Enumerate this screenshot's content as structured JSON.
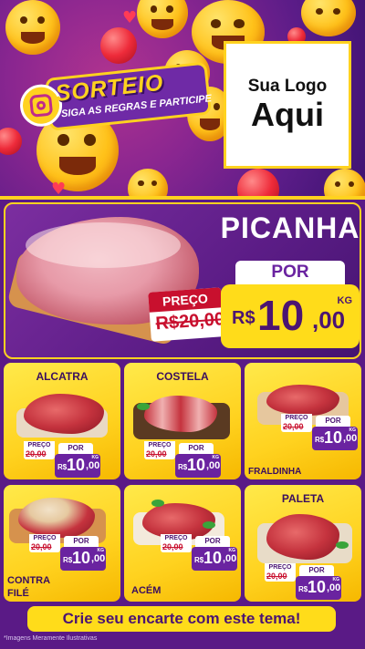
{
  "hero": {
    "sorteio_title": "SORTEIO",
    "sorteio_subtitle": "SIGA AS REGRAS E PARTICIPE",
    "logo_line1": "Sua Logo",
    "logo_line2": "Aqui"
  },
  "featured": {
    "name": "PICANHA",
    "por_label": "POR",
    "preco_label": "PREÇO",
    "old_price": "R$20,00",
    "currency": "R$",
    "price_int": "10",
    "price_dec": ",00",
    "unit": "KG"
  },
  "products": [
    {
      "name": "ALCATRA",
      "preco_label": "PREÇO",
      "old_price": "20,00",
      "por_label": "POR",
      "currency": "R$",
      "price_int": "10",
      "price_dec": ",00",
      "unit": "KG"
    },
    {
      "name": "COSTELA",
      "preco_label": "PREÇO",
      "old_price": "20,00",
      "por_label": "POR",
      "currency": "R$",
      "price_int": "10",
      "price_dec": ",00",
      "unit": "KG"
    },
    {
      "name": "FRALDINHA",
      "preco_label": "PREÇO",
      "old_price": "20,00",
      "por_label": "POR",
      "currency": "R$",
      "price_int": "10",
      "price_dec": ",00",
      "unit": "KG"
    },
    {
      "name": "CONTRA FILÉ",
      "preco_label": "PREÇO",
      "old_price": "20,00",
      "por_label": "POR",
      "currency": "R$",
      "price_int": "10",
      "price_dec": ",00",
      "unit": "KG"
    },
    {
      "name": "ACÉM",
      "preco_label": "PREÇO",
      "old_price": "20,00",
      "por_label": "POR",
      "currency": "R$",
      "price_int": "10",
      "price_dec": ",00",
      "unit": "KG"
    },
    {
      "name": "PALETA",
      "preco_label": "PREÇO",
      "old_price": "20,00",
      "por_label": "POR",
      "currency": "R$",
      "price_int": "10",
      "price_dec": ",00",
      "unit": "KG"
    }
  ],
  "cta": "Crie seu encarte com este tema!",
  "footnote": "*Imagens Meramente Ilustrativas",
  "colors": {
    "purple": "#6a23a0",
    "yellow": "#ffdc1a",
    "red": "#c8102e"
  }
}
